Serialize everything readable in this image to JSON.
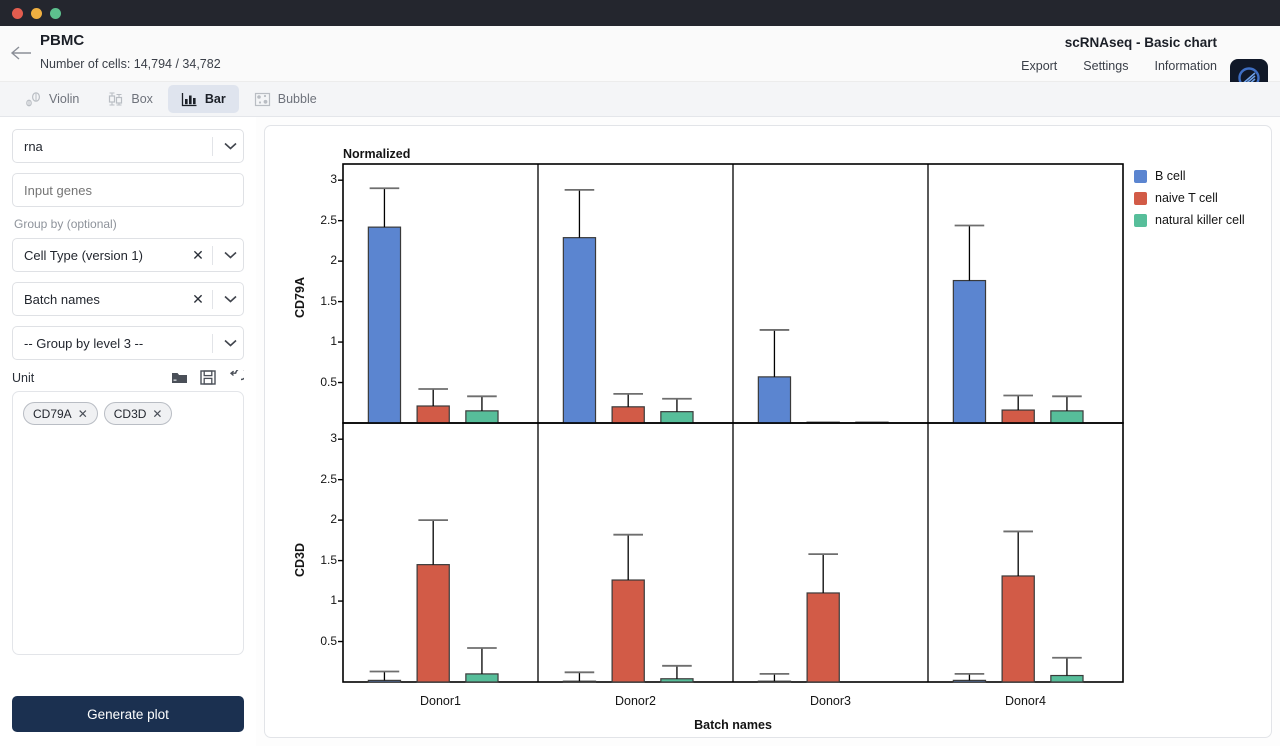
{
  "header": {
    "title": "PBMC",
    "subtitle": "Number of cells: 14,794 / 34,782",
    "app_name": "scRNAseq - Basic chart",
    "menu": [
      "Export",
      "Settings",
      "Information"
    ]
  },
  "tabs": [
    {
      "label": "Violin",
      "active": false
    },
    {
      "label": "Box",
      "active": false
    },
    {
      "label": "Bar",
      "active": true
    },
    {
      "label": "Bubble",
      "active": false
    }
  ],
  "sidebar": {
    "assay": {
      "value": "rna"
    },
    "gene_input": {
      "placeholder": "Input genes",
      "value": ""
    },
    "group_by_label": "Group by (optional)",
    "group_by": [
      {
        "value": "Cell Type (version 1)",
        "clearable": true
      },
      {
        "value": "Batch names",
        "clearable": true
      },
      {
        "value": "-- Group by level 3 --",
        "clearable": false
      }
    ],
    "unit_label": "Unit",
    "selected_genes": [
      "CD79A",
      "CD3D"
    ],
    "generate_button": "Generate plot"
  },
  "chart_data": {
    "type": "bar",
    "subtitle": "Normalized",
    "xlabel": "Batch names",
    "categories": [
      "Donor1",
      "Donor2",
      "Donor3",
      "Donor4"
    ],
    "colors": {
      "B cell": "#5B85D0",
      "naive T cell": "#D25B47",
      "natural killer cell": "#57BE9A"
    },
    "series": [
      {
        "name": "B cell",
        "color": "#5B85D0"
      },
      {
        "name": "naive T cell",
        "color": "#D25B47"
      },
      {
        "name": "natural killer cell",
        "color": "#57BE9A"
      }
    ],
    "panels": [
      {
        "ylabel": "CD79A",
        "ylim": [
          0,
          3.2
        ],
        "yticks": [
          0.5,
          1,
          1.5,
          2,
          2.5,
          3
        ],
        "ytick_labels": [
          "0.5",
          "1",
          "1.5",
          "2",
          "2.5",
          "3"
        ],
        "values": [
          [
            2.42,
            0.21,
            0.15
          ],
          [
            2.29,
            0.2,
            0.14
          ],
          [
            0.57,
            0.01,
            0.01
          ],
          [
            1.76,
            0.16,
            0.15
          ]
        ],
        "errors_high": [
          [
            2.9,
            0.42,
            0.33
          ],
          [
            2.88,
            0.36,
            0.3
          ],
          [
            1.15,
            0.01,
            0.01
          ],
          [
            2.44,
            0.34,
            0.33
          ]
        ]
      },
      {
        "ylabel": "CD3D",
        "ylim": [
          0,
          3.2
        ],
        "yticks": [
          0.5,
          1,
          1.5,
          2,
          2.5,
          3
        ],
        "ytick_labels": [
          "0.5",
          "1",
          "1.5",
          "2",
          "2.5",
          "3"
        ],
        "values": [
          [
            0.02,
            1.45,
            0.1
          ],
          [
            0.01,
            1.26,
            0.04
          ],
          [
            0.01,
            1.1,
            0.0
          ],
          [
            0.02,
            1.31,
            0.08
          ]
        ],
        "errors_high": [
          [
            0.13,
            2.0,
            0.42
          ],
          [
            0.12,
            1.82,
            0.2
          ],
          [
            0.1,
            1.58,
            0.0
          ],
          [
            0.1,
            1.86,
            0.3
          ]
        ]
      }
    ]
  }
}
